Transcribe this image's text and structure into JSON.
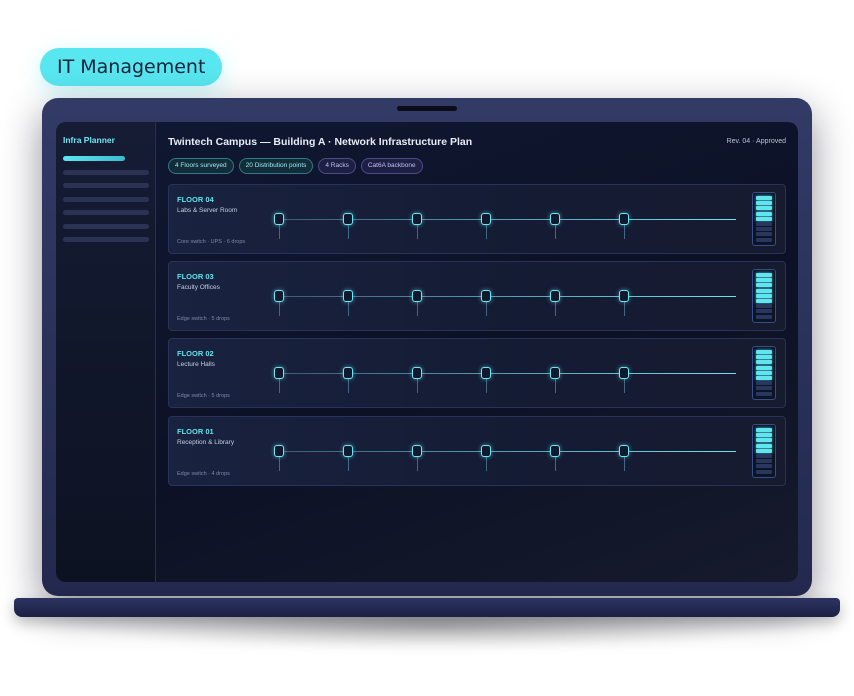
{
  "category_label": "IT Management",
  "sidebar": {
    "title": "Infra Planner"
  },
  "main": {
    "title": "Twintech Campus — Building A · Network Infrastructure Plan",
    "revision": "Rev. 04 · Approved",
    "tags": [
      {
        "label": "4 Floors surveyed",
        "style": "cyan"
      },
      {
        "label": "20 Distribution points",
        "style": "cyan"
      },
      {
        "label": "4 Racks",
        "style": "violet"
      },
      {
        "label": "Cat6A backbone",
        "style": "violet"
      }
    ]
  },
  "floors": [
    {
      "name": "FLOOR 04",
      "description": "Labs & Server Room",
      "note": "Core switch · UPS · 6 drops",
      "drops": 6,
      "rack_units_lit": 5,
      "rack_units_total": 9
    },
    {
      "name": "FLOOR 03",
      "description": "Faculty Offices",
      "note": "Edge switch · 5 drops",
      "drops": 6,
      "rack_units_lit": 6,
      "rack_units_total": 9
    },
    {
      "name": "FLOOR 02",
      "description": "Lecture Halls",
      "note": "Edge switch · 5 drops",
      "drops": 6,
      "rack_units_lit": 6,
      "rack_units_total": 9
    },
    {
      "name": "FLOOR 01",
      "description": "Reception & Library",
      "note": "Edge switch · 4 drops",
      "drops": 6,
      "rack_units_lit": 5,
      "rack_units_total": 9
    }
  ],
  "colors": {
    "accent": "#58e6f0",
    "screen_bg": "#0c1125",
    "lid": "#2a3158"
  }
}
